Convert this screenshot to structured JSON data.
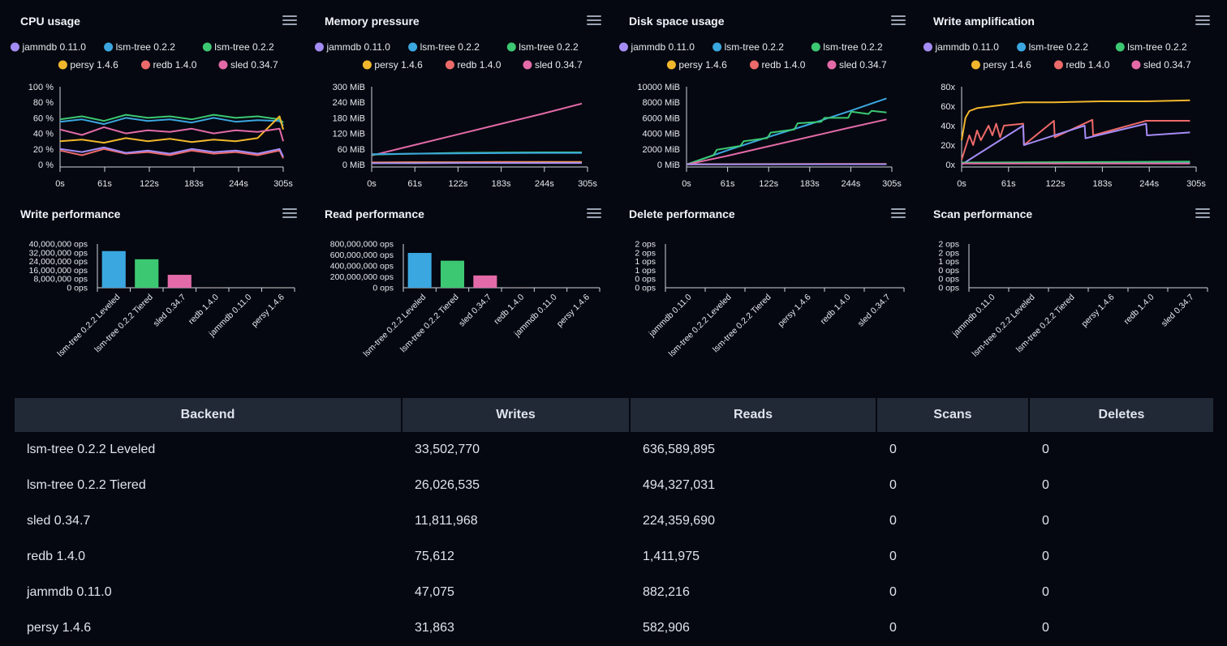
{
  "backends": {
    "jammdb": {
      "name": "jammdb 0.11.0",
      "color": "#a48cf5"
    },
    "lsmA": {
      "name": "lsm-tree 0.2.2",
      "color": "#3ba7e0"
    },
    "lsmB": {
      "name": "lsm-tree 0.2.2",
      "color": "#3cc872"
    },
    "persy": {
      "name": "persy 1.4.6",
      "color": "#f1b72c"
    },
    "redb": {
      "name": "redb 1.4.0",
      "color": "#ec6a6a"
    },
    "sled": {
      "name": "sled 0.34.7",
      "color": "#e36aa8"
    }
  },
  "legend_order": [
    "jammdb",
    "lsmA",
    "lsmB",
    "persy",
    "redb",
    "sled"
  ],
  "panels": {
    "cpu": {
      "title": "CPU usage"
    },
    "mem": {
      "title": "Memory pressure"
    },
    "disk": {
      "title": "Disk space usage"
    },
    "wamp": {
      "title": "Write amplification"
    },
    "wperf": {
      "title": "Write performance"
    },
    "rperf": {
      "title": "Read performance"
    },
    "dperf": {
      "title": "Delete performance"
    },
    "sperf": {
      "title": "Scan performance"
    }
  },
  "chart_data": [
    {
      "id": "cpu",
      "type": "line",
      "title": "CPU usage",
      "x_ticks": [
        "0s",
        "61s",
        "122s",
        "183s",
        "244s",
        "305s"
      ],
      "xlim": [
        0,
        305
      ],
      "y_ticks": [
        "0 %",
        "20 %",
        "40 %",
        "60 %",
        "80 %",
        "100 %"
      ],
      "ylim": [
        0,
        100
      ],
      "series": [
        {
          "key": "lsmA",
          "x": [
            0,
            30,
            60,
            90,
            120,
            150,
            180,
            210,
            240,
            270,
            300,
            305
          ],
          "values": [
            55,
            58,
            52,
            60,
            56,
            58,
            54,
            60,
            55,
            57,
            56,
            50
          ]
        },
        {
          "key": "lsmB",
          "x": [
            0,
            30,
            60,
            90,
            120,
            150,
            180,
            210,
            240,
            270,
            300,
            305
          ],
          "values": [
            58,
            62,
            56,
            64,
            60,
            62,
            58,
            64,
            60,
            62,
            58,
            54
          ]
        },
        {
          "key": "persy",
          "x": [
            0,
            30,
            60,
            90,
            120,
            150,
            180,
            210,
            240,
            270,
            300,
            305
          ],
          "values": [
            30,
            32,
            28,
            34,
            30,
            33,
            29,
            32,
            30,
            34,
            62,
            45
          ]
        },
        {
          "key": "sled",
          "x": [
            0,
            30,
            60,
            90,
            120,
            150,
            180,
            210,
            240,
            270,
            300,
            305
          ],
          "values": [
            45,
            38,
            48,
            40,
            44,
            42,
            46,
            40,
            44,
            42,
            46,
            30
          ]
        },
        {
          "key": "redb",
          "x": [
            0,
            30,
            60,
            90,
            120,
            150,
            180,
            210,
            240,
            270,
            300,
            305
          ],
          "values": [
            18,
            12,
            20,
            14,
            16,
            12,
            18,
            14,
            16,
            12,
            18,
            8
          ]
        },
        {
          "key": "jammdb",
          "x": [
            0,
            30,
            60,
            90,
            120,
            150,
            180,
            210,
            240,
            270,
            300,
            305
          ],
          "values": [
            20,
            16,
            22,
            15,
            18,
            14,
            20,
            16,
            18,
            14,
            20,
            10
          ]
        }
      ]
    },
    {
      "id": "mem",
      "type": "line",
      "title": "Memory pressure",
      "x_ticks": [
        "0s",
        "61s",
        "122s",
        "183s",
        "244s",
        "305s"
      ],
      "xlim": [
        0,
        305
      ],
      "y_ticks": [
        "0 MiB",
        "60 MiB",
        "120 MiB",
        "180 MiB",
        "240 MiB",
        "300 MiB"
      ],
      "ylim": [
        0,
        300
      ],
      "series": [
        {
          "key": "sled",
          "x": [
            0,
            60,
            120,
            180,
            240,
            297
          ],
          "values": [
            35,
            75,
            115,
            155,
            195,
            235
          ]
        },
        {
          "key": "lsmB",
          "x": [
            0,
            60,
            120,
            180,
            240,
            297
          ],
          "values": [
            38,
            42,
            45,
            46,
            47,
            47
          ]
        },
        {
          "key": "lsmA",
          "x": [
            0,
            60,
            120,
            180,
            240,
            297
          ],
          "values": [
            40,
            42,
            43,
            44,
            45,
            45
          ]
        },
        {
          "key": "redb",
          "x": [
            0,
            60,
            120,
            180,
            240,
            297
          ],
          "values": [
            8,
            9,
            9,
            10,
            10,
            10
          ]
        },
        {
          "key": "persy",
          "x": [
            0,
            60,
            120,
            180,
            240,
            297
          ],
          "values": [
            6,
            7,
            7,
            7,
            8,
            8
          ]
        },
        {
          "key": "jammdb",
          "x": [
            0,
            60,
            120,
            180,
            240,
            297
          ],
          "values": [
            5,
            5,
            6,
            6,
            6,
            6
          ]
        }
      ]
    },
    {
      "id": "disk",
      "type": "line",
      "title": "Disk space usage",
      "x_ticks": [
        "0s",
        "61s",
        "122s",
        "183s",
        "244s",
        "305s"
      ],
      "xlim": [
        0,
        305
      ],
      "y_ticks": [
        "0 MiB",
        "2000 MiB",
        "4000 MiB",
        "6000 MiB",
        "8000 MiB",
        "10000 MiB"
      ],
      "ylim": [
        0,
        10000
      ],
      "series": [
        {
          "key": "lsmA",
          "x": [
            0,
            60,
            120,
            180,
            240,
            297
          ],
          "values": [
            0,
            1800,
            3500,
            5100,
            6800,
            8500
          ]
        },
        {
          "key": "lsmB",
          "x": [
            0,
            40,
            45,
            80,
            85,
            120,
            125,
            160,
            165,
            200,
            205,
            240,
            245,
            270,
            275,
            297
          ],
          "values": [
            0,
            1200,
            1900,
            2400,
            3000,
            3400,
            4100,
            4500,
            5300,
            5500,
            6000,
            6000,
            6800,
            6500,
            6900,
            6700
          ]
        },
        {
          "key": "sled",
          "x": [
            0,
            60,
            120,
            180,
            240,
            297
          ],
          "values": [
            0,
            1100,
            2300,
            3500,
            4700,
            5800
          ]
        },
        {
          "key": "redb",
          "x": [
            0,
            297
          ],
          "values": [
            50,
            80
          ]
        },
        {
          "key": "persy",
          "x": [
            0,
            297
          ],
          "values": [
            30,
            50
          ]
        },
        {
          "key": "jammdb",
          "x": [
            0,
            297
          ],
          "values": [
            20,
            40
          ]
        }
      ]
    },
    {
      "id": "wamp",
      "type": "line",
      "title": "Write amplification",
      "x_ticks": [
        "0s",
        "61s",
        "122s",
        "183s",
        "244s",
        "305s"
      ],
      "xlim": [
        0,
        305
      ],
      "y_ticks": [
        "0x",
        "20x",
        "40x",
        "60x",
        "80x"
      ],
      "ylim": [
        0,
        80
      ],
      "series": [
        {
          "key": "persy",
          "x": [
            0,
            5,
            10,
            20,
            40,
            60,
            80,
            120,
            180,
            240,
            297
          ],
          "values": [
            25,
            48,
            55,
            58,
            60,
            62,
            64,
            64,
            65,
            65,
            66
          ]
        },
        {
          "key": "redb",
          "x": [
            0,
            10,
            15,
            20,
            25,
            35,
            40,
            45,
            50,
            55,
            80,
            81,
            120,
            121,
            170,
            171,
            240,
            297
          ],
          "values": [
            5,
            30,
            20,
            35,
            25,
            40,
            30,
            42,
            28,
            40,
            42,
            20,
            45,
            28,
            46,
            30,
            45,
            45
          ]
        },
        {
          "key": "jammdb",
          "x": [
            0,
            80,
            81,
            160,
            161,
            240,
            241,
            297
          ],
          "values": [
            0,
            40,
            20,
            40,
            27,
            42,
            30,
            33
          ]
        },
        {
          "key": "lsmA",
          "x": [
            0,
            297
          ],
          "values": [
            2,
            2
          ]
        },
        {
          "key": "lsmB",
          "x": [
            0,
            297
          ],
          "values": [
            2,
            3
          ]
        },
        {
          "key": "sled",
          "x": [
            0,
            297
          ],
          "values": [
            1,
            1
          ]
        }
      ]
    },
    {
      "id": "wperf",
      "type": "bar",
      "title": "Write performance",
      "categories": [
        "lsm-tree 0.2.2 Leveled",
        "lsm-tree 0.2.2 Tiered",
        "sled 0.34.7",
        "redb 1.4.0",
        "jammdb 0.11.0",
        "persy 1.4.6"
      ],
      "values": [
        33502770,
        26026535,
        11811968,
        75612,
        47075,
        31863
      ],
      "colors": [
        "#3ba7e0",
        "#3cc872",
        "#e36aa8",
        "#ec6a6a",
        "#a48cf5",
        "#f1b72c"
      ],
      "y_ticks": [
        "0 ops",
        "8,000,000 ops",
        "16,000,000 ops",
        "24,000,000 ops",
        "32,000,000 ops",
        "40,000,000 ops"
      ],
      "ylim": [
        0,
        40000000
      ]
    },
    {
      "id": "rperf",
      "type": "bar",
      "title": "Read performance",
      "categories": [
        "lsm-tree 0.2.2 Leveled",
        "lsm-tree 0.2.2 Tiered",
        "sled 0.34.7",
        "redb 1.4.0",
        "jammdb 0.11.0",
        "persy 1.4.6"
      ],
      "values": [
        636589895,
        494327031,
        224359690,
        1411975,
        882216,
        582906
      ],
      "colors": [
        "#3ba7e0",
        "#3cc872",
        "#e36aa8",
        "#ec6a6a",
        "#a48cf5",
        "#f1b72c"
      ],
      "y_ticks": [
        "0 ops",
        "200,000,000 ops",
        "400,000,000 ops",
        "600,000,000 ops",
        "800,000,000 ops"
      ],
      "ylim": [
        0,
        800000000
      ]
    },
    {
      "id": "dperf",
      "type": "bar",
      "title": "Delete performance",
      "categories": [
        "jammdb 0.11.0",
        "lsm-tree 0.2.2 Leveled",
        "lsm-tree 0.2.2 Tiered",
        "persy 1.4.6",
        "redb 1.4.0",
        "sled 0.34.7"
      ],
      "values": [
        0,
        0,
        0,
        0,
        0,
        0
      ],
      "colors": [
        "#a48cf5",
        "#3ba7e0",
        "#3cc872",
        "#f1b72c",
        "#ec6a6a",
        "#e36aa8"
      ],
      "y_ticks": [
        "0 ops",
        "0 ops",
        "1 ops",
        "1 ops",
        "2 ops",
        "2 ops"
      ],
      "ylim": [
        0,
        2
      ]
    },
    {
      "id": "sperf",
      "type": "bar",
      "title": "Scan performance",
      "categories": [
        "jammdb 0.11.0",
        "lsm-tree 0.2.2 Leveled",
        "lsm-tree 0.2.2 Tiered",
        "persy 1.4.6",
        "redb 1.4.0",
        "sled 0.34.7"
      ],
      "values": [
        0,
        0,
        0,
        0,
        0,
        0
      ],
      "colors": [
        "#a48cf5",
        "#3ba7e0",
        "#3cc872",
        "#f1b72c",
        "#ec6a6a",
        "#e36aa8"
      ],
      "y_ticks": [
        "0 ops",
        "0 ops",
        "0 ops",
        "1 ops",
        "2 ops",
        "2 ops"
      ],
      "ylim": [
        0,
        2
      ]
    }
  ],
  "table": {
    "headers": [
      "Backend",
      "Writes",
      "Reads",
      "Scans",
      "Deletes"
    ],
    "rows": [
      [
        "lsm-tree 0.2.2 Leveled",
        "33,502,770",
        "636,589,895",
        "0",
        "0"
      ],
      [
        "lsm-tree 0.2.2 Tiered",
        "26,026,535",
        "494,327,031",
        "0",
        "0"
      ],
      [
        "sled 0.34.7",
        "11,811,968",
        "224,359,690",
        "0",
        "0"
      ],
      [
        "redb 1.4.0",
        "75,612",
        "1,411,975",
        "0",
        "0"
      ],
      [
        "jammdb 0.11.0",
        "47,075",
        "882,216",
        "0",
        "0"
      ],
      [
        "persy 1.4.6",
        "31,863",
        "582,906",
        "0",
        "0"
      ]
    ]
  }
}
